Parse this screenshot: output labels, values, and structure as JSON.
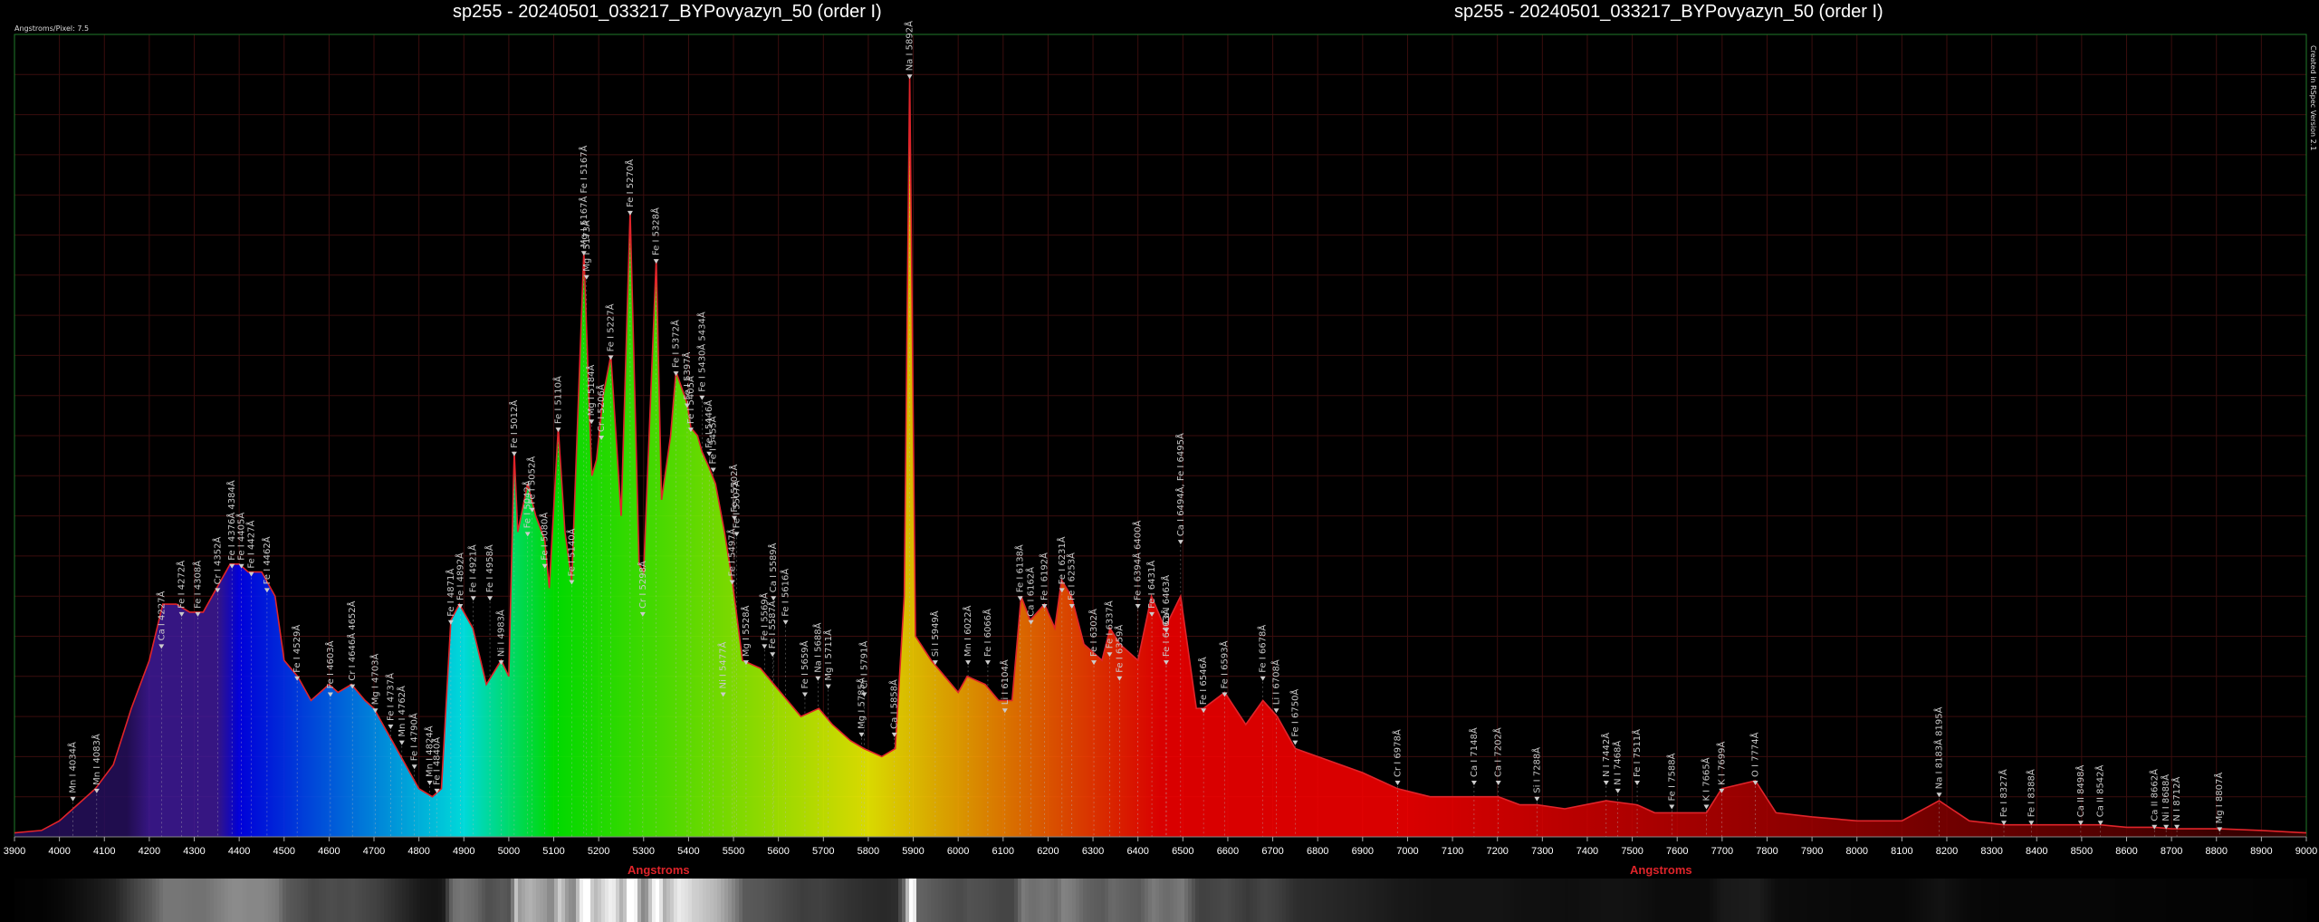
{
  "titles": {
    "left": "sp255 - 20240501_033217_BYPovyazyn_50 (order I)",
    "right": "sp255 - 20240501_033217_BYPovyazyn_50 (order I)"
  },
  "pixel_note": "Angstroms/Pixel: 7.5",
  "side_note": "Created in RSpec Version 2.1",
  "colors": {
    "curve": "#e0242a",
    "grid": "#3a0d0d",
    "frame": "#1f7a2a",
    "axis_text": "#ffffff"
  },
  "chart_data": {
    "type": "line",
    "xlabel": "Angstroms",
    "ylabel": "",
    "xlim": [
      3900,
      9000
    ],
    "ylim": [
      0,
      1
    ],
    "grid": true,
    "x_ticks": [
      3900,
      4000,
      4100,
      4200,
      4300,
      4400,
      4500,
      4600,
      4700,
      4800,
      4900,
      5000,
      5100,
      5200,
      5300,
      5400,
      5500,
      5600,
      5700,
      5800,
      5900,
      6000,
      6100,
      6200,
      6300,
      6400,
      6500,
      6600,
      6700,
      6800,
      6900,
      7000,
      7100,
      7200,
      7300,
      7400,
      7500,
      7600,
      7700,
      7800,
      7900,
      8000,
      8100,
      8200,
      8300,
      8400,
      8500,
      8600,
      8700,
      8800,
      8900,
      9000
    ],
    "series": [
      {
        "values": [
          [
            3900,
            0.005
          ],
          [
            3960,
            0.008
          ],
          [
            4000,
            0.02
          ],
          [
            4040,
            0.04
          ],
          [
            4080,
            0.06
          ],
          [
            4120,
            0.09
          ],
          [
            4160,
            0.16
          ],
          [
            4200,
            0.22
          ],
          [
            4230,
            0.29
          ],
          [
            4260,
            0.29
          ],
          [
            4290,
            0.28
          ],
          [
            4320,
            0.28
          ],
          [
            4350,
            0.31
          ],
          [
            4380,
            0.34
          ],
          [
            4400,
            0.34
          ],
          [
            4420,
            0.33
          ],
          [
            4450,
            0.33
          ],
          [
            4480,
            0.3
          ],
          [
            4500,
            0.22
          ],
          [
            4530,
            0.2
          ],
          [
            4560,
            0.17
          ],
          [
            4600,
            0.19
          ],
          [
            4620,
            0.18
          ],
          [
            4650,
            0.19
          ],
          [
            4680,
            0.17
          ],
          [
            4700,
            0.16
          ],
          [
            4720,
            0.14
          ],
          [
            4740,
            0.12
          ],
          [
            4760,
            0.1
          ],
          [
            4780,
            0.08
          ],
          [
            4800,
            0.06
          ],
          [
            4830,
            0.05
          ],
          [
            4850,
            0.06
          ],
          [
            4871,
            0.27
          ],
          [
            4890,
            0.29
          ],
          [
            4920,
            0.26
          ],
          [
            4950,
            0.19
          ],
          [
            4983,
            0.22
          ],
          [
            5000,
            0.2
          ],
          [
            5012,
            0.48
          ],
          [
            5020,
            0.38
          ],
          [
            5042,
            0.44
          ],
          [
            5060,
            0.4
          ],
          [
            5080,
            0.37
          ],
          [
            5090,
            0.31
          ],
          [
            5110,
            0.51
          ],
          [
            5125,
            0.38
          ],
          [
            5140,
            0.32
          ],
          [
            5167,
            0.73
          ],
          [
            5180,
            0.52
          ],
          [
            5185,
            0.45
          ],
          [
            5195,
            0.47
          ],
          [
            5210,
            0.55
          ],
          [
            5227,
            0.6
          ],
          [
            5250,
            0.4
          ],
          [
            5270,
            0.78
          ],
          [
            5290,
            0.34
          ],
          [
            5300,
            0.33
          ],
          [
            5328,
            0.72
          ],
          [
            5340,
            0.42
          ],
          [
            5360,
            0.5
          ],
          [
            5372,
            0.58
          ],
          [
            5397,
            0.54
          ],
          [
            5405,
            0.51
          ],
          [
            5420,
            0.5
          ],
          [
            5430,
            0.48
          ],
          [
            5446,
            0.46
          ],
          [
            5460,
            0.44
          ],
          [
            5480,
            0.38
          ],
          [
            5497,
            0.32
          ],
          [
            5520,
            0.22
          ],
          [
            5560,
            0.21
          ],
          [
            5590,
            0.19
          ],
          [
            5620,
            0.17
          ],
          [
            5650,
            0.15
          ],
          [
            5690,
            0.16
          ],
          [
            5720,
            0.14
          ],
          [
            5760,
            0.12
          ],
          [
            5790,
            0.11
          ],
          [
            5830,
            0.1
          ],
          [
            5860,
            0.11
          ],
          [
            5880,
            0.3
          ],
          [
            5892,
            0.95
          ],
          [
            5905,
            0.25
          ],
          [
            5940,
            0.22
          ],
          [
            5970,
            0.2
          ],
          [
            6000,
            0.18
          ],
          [
            6020,
            0.2
          ],
          [
            6060,
            0.19
          ],
          [
            6090,
            0.17
          ],
          [
            6120,
            0.17
          ],
          [
            6140,
            0.3
          ],
          [
            6160,
            0.27
          ],
          [
            6192,
            0.29
          ],
          [
            6215,
            0.26
          ],
          [
            6230,
            0.32
          ],
          [
            6252,
            0.3
          ],
          [
            6280,
            0.24
          ],
          [
            6300,
            0.23
          ],
          [
            6320,
            0.22
          ],
          [
            6338,
            0.26
          ],
          [
            6360,
            0.24
          ],
          [
            6400,
            0.22
          ],
          [
            6430,
            0.3
          ],
          [
            6460,
            0.26
          ],
          [
            6495,
            0.3
          ],
          [
            6530,
            0.16
          ],
          [
            6546,
            0.16
          ],
          [
            6593,
            0.18
          ],
          [
            6640,
            0.14
          ],
          [
            6678,
            0.17
          ],
          [
            6710,
            0.15
          ],
          [
            6750,
            0.11
          ],
          [
            6800,
            0.1
          ],
          [
            6900,
            0.08
          ],
          [
            6978,
            0.06
          ],
          [
            7050,
            0.05
          ],
          [
            7148,
            0.05
          ],
          [
            7202,
            0.05
          ],
          [
            7250,
            0.04
          ],
          [
            7288,
            0.04
          ],
          [
            7350,
            0.035
          ],
          [
            7442,
            0.045
          ],
          [
            7511,
            0.04
          ],
          [
            7550,
            0.03
          ],
          [
            7588,
            0.03
          ],
          [
            7665,
            0.03
          ],
          [
            7699,
            0.06
          ],
          [
            7774,
            0.07
          ],
          [
            7820,
            0.03
          ],
          [
            7900,
            0.025
          ],
          [
            8000,
            0.02
          ],
          [
            8100,
            0.02
          ],
          [
            8183,
            0.045
          ],
          [
            8250,
            0.02
          ],
          [
            8327,
            0.015
          ],
          [
            8400,
            0.015
          ],
          [
            8498,
            0.015
          ],
          [
            8542,
            0.015
          ],
          [
            8600,
            0.012
          ],
          [
            8662,
            0.012
          ],
          [
            8700,
            0.01
          ],
          [
            8807,
            0.01
          ],
          [
            8900,
            0.008
          ],
          [
            9000,
            0.005
          ]
        ]
      }
    ],
    "annotations": [
      {
        "x": 4030,
        "y": 0.05,
        "text": "Mn I 4034Å"
      },
      {
        "x": 4083,
        "y": 0.06,
        "text": "Mn I 4083Å"
      },
      {
        "x": 4227,
        "y": 0.24,
        "text": "Ca I 4227Å"
      },
      {
        "x": 4272,
        "y": 0.28,
        "text": "Fe I 4272Å"
      },
      {
        "x": 4308,
        "y": 0.28,
        "text": "Fe I 4308Å"
      },
      {
        "x": 4352,
        "y": 0.31,
        "text": "Cr I 4352Å"
      },
      {
        "x": 4384,
        "y": 0.34,
        "text": "Fe I 4376Å 4384Å"
      },
      {
        "x": 4405,
        "y": 0.34,
        "text": "Fe I 4405Å"
      },
      {
        "x": 4427,
        "y": 0.33,
        "text": "Fe I 4427Å"
      },
      {
        "x": 4462,
        "y": 0.31,
        "text": "Fe I 4462Å"
      },
      {
        "x": 4529,
        "y": 0.2,
        "text": "Fe I 4529Å"
      },
      {
        "x": 4603,
        "y": 0.18,
        "text": "Fe I 4603Å"
      },
      {
        "x": 4652,
        "y": 0.19,
        "text": "Cr I 4646Å 4652Å"
      },
      {
        "x": 4703,
        "y": 0.16,
        "text": "Mg I 4703Å"
      },
      {
        "x": 4737,
        "y": 0.14,
        "text": "Fe I 4737Å"
      },
      {
        "x": 4762,
        "y": 0.12,
        "text": "Mn I 4762Å"
      },
      {
        "x": 4790,
        "y": 0.09,
        "text": "Fe I 4790Å"
      },
      {
        "x": 4824,
        "y": 0.07,
        "text": "Mn I 4824Å"
      },
      {
        "x": 4840,
        "y": 0.06,
        "text": "Fe I 4840Å"
      },
      {
        "x": 4871,
        "y": 0.27,
        "text": "Fe I 4871Å"
      },
      {
        "x": 4892,
        "y": 0.29,
        "text": "Fe I 4892Å"
      },
      {
        "x": 4921,
        "y": 0.3,
        "text": "Fe I 4921Å"
      },
      {
        "x": 4958,
        "y": 0.3,
        "text": "Fe I 4958Å"
      },
      {
        "x": 4983,
        "y": 0.22,
        "text": "Ni I 4983Å"
      },
      {
        "x": 5012,
        "y": 0.48,
        "text": "Fe I 5012Å"
      },
      {
        "x": 5042,
        "y": 0.38,
        "text": "Fe I 5042Å"
      },
      {
        "x": 5052,
        "y": 0.41,
        "text": "Fe I 5052Å"
      },
      {
        "x": 5080,
        "y": 0.34,
        "text": "Fe I 5080Å"
      },
      {
        "x": 5110,
        "y": 0.51,
        "text": "Fe I 5110Å"
      },
      {
        "x": 5140,
        "y": 0.32,
        "text": "Fe I 5140Å"
      },
      {
        "x": 5167,
        "y": 0.73,
        "text": "Mg I 5167Å Fe I 5167Å"
      },
      {
        "x": 5173,
        "y": 0.7,
        "text": "Mg I 5173Å"
      },
      {
        "x": 5184,
        "y": 0.52,
        "text": "Mg I 5184Å"
      },
      {
        "x": 5206,
        "y": 0.5,
        "text": "Cr I 5206Å"
      },
      {
        "x": 5227,
        "y": 0.6,
        "text": "Fe I 5227Å"
      },
      {
        "x": 5270,
        "y": 0.78,
        "text": "Fe I 5270Å"
      },
      {
        "x": 5298,
        "y": 0.28,
        "text": "Cr I 5298Å"
      },
      {
        "x": 5328,
        "y": 0.72,
        "text": "Fe I 5328Å"
      },
      {
        "x": 5372,
        "y": 0.58,
        "text": "Fe I 5372Å"
      },
      {
        "x": 5397,
        "y": 0.54,
        "text": "Fe I 5397Å"
      },
      {
        "x": 5405,
        "y": 0.51,
        "text": "Fe I 5405Å"
      },
      {
        "x": 5430,
        "y": 0.55,
        "text": "Fe I 5430Å 5434Å"
      },
      {
        "x": 5446,
        "y": 0.48,
        "text": "Fe I 5446Å"
      },
      {
        "x": 5455,
        "y": 0.46,
        "text": "Fe I 5455Å"
      },
      {
        "x": 5477,
        "y": 0.18,
        "text": "Ni I 5477Å"
      },
      {
        "x": 5497,
        "y": 0.32,
        "text": "Fe I 5497Å"
      },
      {
        "x": 5502,
        "y": 0.4,
        "text": "Fe I 5502Å"
      },
      {
        "x": 5507,
        "y": 0.38,
        "text": "Fe I 5507Å"
      },
      {
        "x": 5528,
        "y": 0.22,
        "text": "Mg I 5528Å"
      },
      {
        "x": 5569,
        "y": 0.24,
        "text": "Fe I 5569Å"
      },
      {
        "x": 5587,
        "y": 0.23,
        "text": "Fe I 5587Å"
      },
      {
        "x": 5589,
        "y": 0.3,
        "text": "Ca I 5589Å"
      },
      {
        "x": 5616,
        "y": 0.27,
        "text": "Fe I 5616Å"
      },
      {
        "x": 5659,
        "y": 0.18,
        "text": "Fe I 5659Å"
      },
      {
        "x": 5688,
        "y": 0.2,
        "text": "Na I 5688Å"
      },
      {
        "x": 5711,
        "y": 0.19,
        "text": "Mg I 5711Å"
      },
      {
        "x": 5785,
        "y": 0.13,
        "text": "Mg I 5785Å"
      },
      {
        "x": 5791,
        "y": 0.18,
        "text": "Cr I 5791Å"
      },
      {
        "x": 5858,
        "y": 0.13,
        "text": "Ca I 5858Å"
      },
      {
        "x": 5892,
        "y": 0.95,
        "text": "Na I 5892Å"
      },
      {
        "x": 5949,
        "y": 0.22,
        "text": "Si I 5949Å"
      },
      {
        "x": 6022,
        "y": 0.22,
        "text": "Mn I 6022Å"
      },
      {
        "x": 6066,
        "y": 0.22,
        "text": "Fe I 6066Å"
      },
      {
        "x": 6104,
        "y": 0.16,
        "text": "Li I 6104Å"
      },
      {
        "x": 6138,
        "y": 0.3,
        "text": "Fe I 6138Å"
      },
      {
        "x": 6162,
        "y": 0.27,
        "text": "Ca I 6162Å"
      },
      {
        "x": 6192,
        "y": 0.29,
        "text": "Fe I 6192Å"
      },
      {
        "x": 6231,
        "y": 0.31,
        "text": "Fe I 6231Å"
      },
      {
        "x": 6253,
        "y": 0.29,
        "text": "Fe I 6253Å"
      },
      {
        "x": 6302,
        "y": 0.22,
        "text": "Fe I 6302Å"
      },
      {
        "x": 6337,
        "y": 0.23,
        "text": "Fe I 6337Å"
      },
      {
        "x": 6359,
        "y": 0.2,
        "text": "Fe I 6359Å"
      },
      {
        "x": 6400,
        "y": 0.29,
        "text": "Fe I 6394Å 6400Å"
      },
      {
        "x": 6431,
        "y": 0.28,
        "text": "Fe I 6431Å"
      },
      {
        "x": 6463,
        "y": 0.26,
        "text": "Ca I 6463Å"
      },
      {
        "x": 6463,
        "y": 0.22,
        "text": "Fe I 6463Å"
      },
      {
        "x": 6495,
        "y": 0.37,
        "text": "Ca I 6494Å, Fe I 6495Å"
      },
      {
        "x": 6546,
        "y": 0.16,
        "text": "Fe I 6546Å"
      },
      {
        "x": 6593,
        "y": 0.18,
        "text": "Fe I 6593Å"
      },
      {
        "x": 6678,
        "y": 0.2,
        "text": "Fe I 6678Å"
      },
      {
        "x": 6708,
        "y": 0.16,
        "text": "Li I 6708Å"
      },
      {
        "x": 6750,
        "y": 0.12,
        "text": "Fe I 6750Å"
      },
      {
        "x": 6978,
        "y": 0.07,
        "text": "Cr I 6978Å"
      },
      {
        "x": 7148,
        "y": 0.07,
        "text": "Ca I 7148Å"
      },
      {
        "x": 7202,
        "y": 0.07,
        "text": "Ca I 7202Å"
      },
      {
        "x": 7288,
        "y": 0.05,
        "text": "Si I 7288Å"
      },
      {
        "x": 7442,
        "y": 0.07,
        "text": "N I 7442Å"
      },
      {
        "x": 7468,
        "y": 0.06,
        "text": "N I 7468Å"
      },
      {
        "x": 7511,
        "y": 0.07,
        "text": "Fe I 7511Å"
      },
      {
        "x": 7588,
        "y": 0.04,
        "text": "Fe I 7588Å"
      },
      {
        "x": 7665,
        "y": 0.04,
        "text": "K I 7665Å"
      },
      {
        "x": 7699,
        "y": 0.06,
        "text": "K I 7699Å"
      },
      {
        "x": 7774,
        "y": 0.07,
        "text": "O I 7774Å"
      },
      {
        "x": 8183,
        "y": 0.055,
        "text": "Na I 8183Å 8195Å"
      },
      {
        "x": 8327,
        "y": 0.02,
        "text": "Fe I 8327Å"
      },
      {
        "x": 8388,
        "y": 0.02,
        "text": "Fe I 8388Å"
      },
      {
        "x": 8498,
        "y": 0.02,
        "text": "Ca II 8498Å"
      },
      {
        "x": 8542,
        "y": 0.02,
        "text": "Ca II 8542Å"
      },
      {
        "x": 8662,
        "y": 0.015,
        "text": "Ca II 8662Å"
      },
      {
        "x": 8688,
        "y": 0.015,
        "text": "Ni I 8688Å"
      },
      {
        "x": 8712,
        "y": 0.015,
        "text": "N I 8712Å"
      },
      {
        "x": 8807,
        "y": 0.012,
        "text": "Mg I 8807Å"
      }
    ]
  }
}
